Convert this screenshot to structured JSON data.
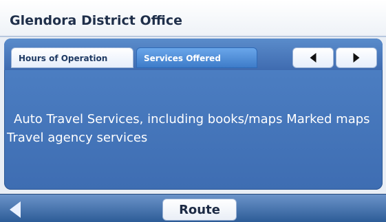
{
  "header": {
    "title": "Glendora District Office"
  },
  "tabs": [
    {
      "label": "Hours of Operation",
      "state": "inactive"
    },
    {
      "label": "Services Offered",
      "state": "active"
    }
  ],
  "nav": {
    "prev_icon": "triangle-left-icon",
    "next_icon": "triangle-right-icon"
  },
  "content": {
    "line1": "Auto Travel Services, including books/maps Marked maps",
    "line2": "Travel agency services"
  },
  "footer": {
    "back_icon": "back-arrow-icon",
    "route_label": "Route"
  },
  "colors": {
    "panel_blue": "#4f82c6",
    "active_tab_blue": "#3e7cc9",
    "footer_blue": "#2d5c97"
  }
}
